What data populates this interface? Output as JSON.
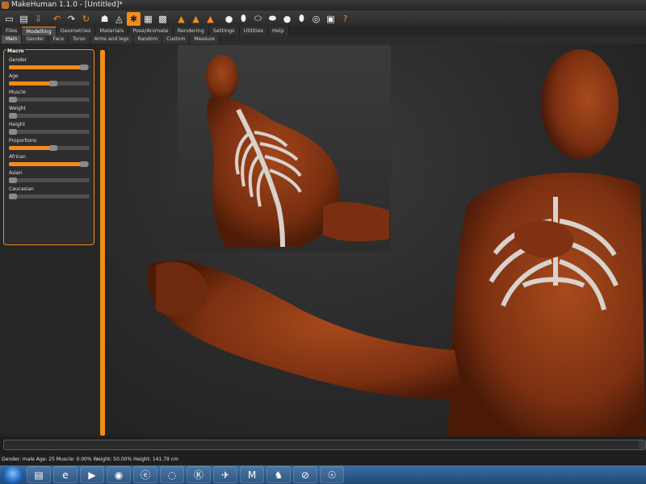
{
  "window": {
    "title": "MakeHuman 1.1.0 - [Untitled]*"
  },
  "toolbar": {
    "icons": [
      "new-file-icon",
      "save-icon",
      "export-icon",
      "undo-icon",
      "redo-icon",
      "reset-icon",
      "smooth-icon",
      "wireframe-icon",
      "pose-icon",
      "grid-icon",
      "checker-icon",
      "front-view-icon",
      "back-view-icon",
      "side-view-icon",
      "head-icon",
      "right-view-icon",
      "left-view-icon",
      "top-view-icon",
      "bottom-view-icon",
      "reset-camera-icon",
      "screenshot-icon",
      "help-icon"
    ]
  },
  "main_tabs": [
    "Files",
    "Modelling",
    "Geometries",
    "Materials",
    "Pose/Animate",
    "Rendering",
    "Settings",
    "Utilities",
    "Help"
  ],
  "active_main_tab": "Modelling",
  "sub_tabs": [
    "Main",
    "Gender",
    "Face",
    "Torso",
    "Arms and legs",
    "Random",
    "Custom",
    "Measure"
  ],
  "active_sub_tab": "Main",
  "macro": {
    "title": "Macro",
    "sliders": [
      {
        "label": "Gender",
        "value": 0.88
      },
      {
        "label": "Age",
        "value": 0.5
      },
      {
        "label": "Muscle",
        "value": 0.0
      },
      {
        "label": "Weight",
        "value": 0.0
      },
      {
        "label": "Height",
        "value": 0.0
      },
      {
        "label": "Proportions",
        "value": 0.5
      },
      {
        "label": "African",
        "value": 0.88
      },
      {
        "label": "Asian",
        "value": 0.0
      },
      {
        "label": "Caucasian",
        "value": 0.0
      }
    ]
  },
  "status": {
    "text": "Gender: male Age: 25 Muscle: 0.00% Weight: 50.00% Height: 141.79 cm"
  },
  "colors": {
    "accent": "#f08c1c",
    "skin": "#8a3a16",
    "bone": "#d8d2cc"
  },
  "taskbar": {
    "items": [
      "explorer-icon",
      "ie-icon",
      "media-player-icon",
      "qq-icon",
      "browser-e-icon",
      "edge-icon",
      "k-icon",
      "bird-icon",
      "m-icon",
      "chess-icon",
      "security-icon",
      "makehuman-icon"
    ]
  }
}
